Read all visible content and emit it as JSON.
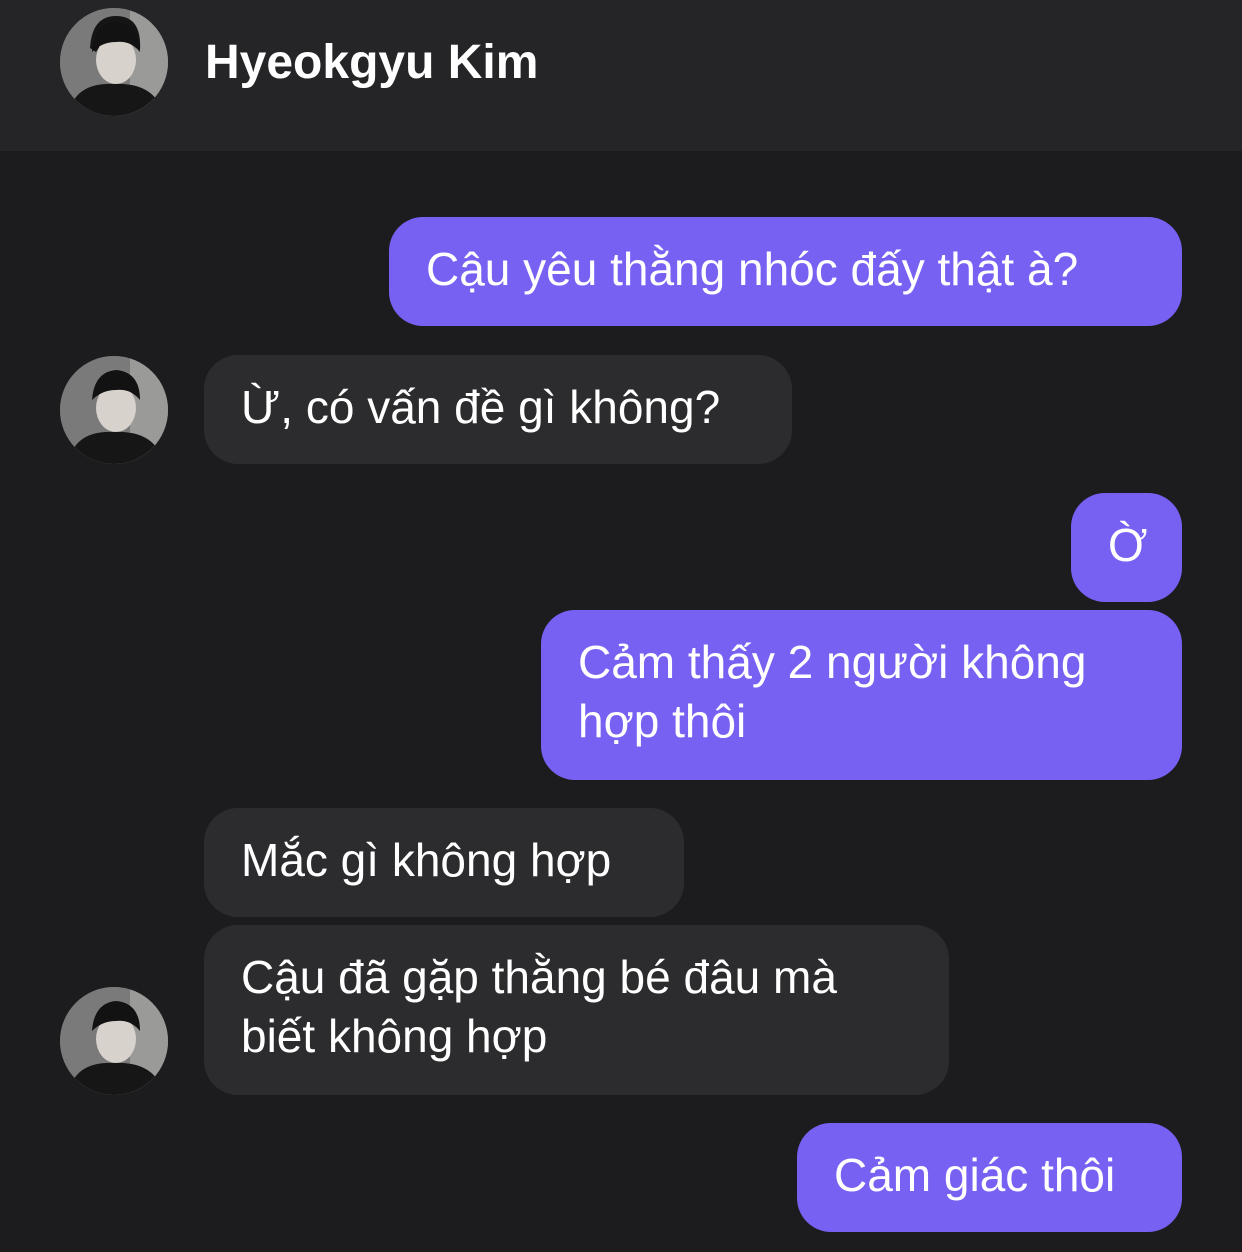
{
  "header": {
    "contact_name": "Hyeokgyu Kim",
    "avatar_icon": "profile-photo-icon"
  },
  "colors": {
    "background": "#1c1c1e",
    "header_background": "#252527",
    "sent_bubble": "#7761f3",
    "received_bubble": "#2c2c2e",
    "text": "#ffffff"
  },
  "messages": [
    {
      "direction": "sent",
      "text": "Cậu yêu thằng nhóc đấy thật à?"
    },
    {
      "direction": "received",
      "text": "Ừ, có vấn đề gì không?"
    },
    {
      "direction": "sent",
      "text": "Ờ"
    },
    {
      "direction": "sent",
      "lines": [
        "Cảm thấy 2 người không",
        "hợp thôi"
      ]
    },
    {
      "direction": "received",
      "text": "Mắc gì không hợp"
    },
    {
      "direction": "received",
      "lines": [
        "Cậu đã gặp thằng bé đâu mà",
        "biết không hợp"
      ]
    },
    {
      "direction": "sent",
      "text": "Cảm giác thôi"
    }
  ]
}
